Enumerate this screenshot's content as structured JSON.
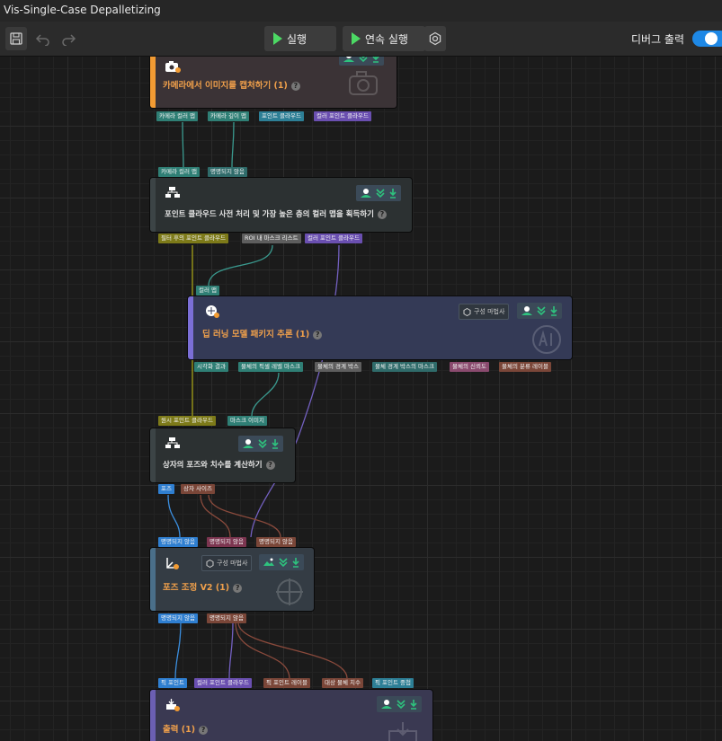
{
  "app": {
    "title": "Vis-Single-Case Depalletizing"
  },
  "toolbar": {
    "run_label": "실행",
    "continuous_run_label": "연속 실행",
    "debug_output_label": "디버그 출력",
    "debug_output_on": true
  },
  "colors": {
    "accent": "#1e88e5",
    "play": "#4cd964",
    "node_title_orange": "#f0a04b",
    "port_teal": "#2f7f75",
    "port_purple": "#6a4fb0",
    "port_olive": "#7d7a19",
    "port_brown": "#7a4638",
    "port_blue": "#2f7fd1"
  },
  "nodes": {
    "capture": {
      "title": "카메라에서 이미지를 캡처하기 (1)",
      "outputs": [
        "카메라 컬러 맵",
        "카메라 깊이 맵",
        "포인트 클라우드",
        "컬러 포인트 클라우드"
      ]
    },
    "preprocess": {
      "inputs": [
        "카메라 컬러 맵",
        "명명되지 않음"
      ],
      "title": "포인트 클라우드 사전 처리 및 가장 높은 층의 컬러 맵을 획득하기",
      "outputs": [
        "필터 후의 포인트 클라우드",
        "ROI 내 마스크 리스트",
        "컬러 포인트 클라우드"
      ]
    },
    "deep": {
      "inputs": [
        "컬러 맵"
      ],
      "config_label": "구성 마법사",
      "title": "딥 러닝 모델 패키지 추론 (1)",
      "outputs": [
        "시각화 결과",
        "물체의 픽셀 레벨 마스크",
        "물체의 경계 박스",
        "물체 경계 박스의 마스크",
        "물체의 신뢰도",
        "물체의 분류 레이블"
      ]
    },
    "box": {
      "inputs": [
        "원시 포인트 클라우드",
        "마스크 이미지"
      ],
      "title": "상자의 포즈와 치수를 계산하기",
      "outputs": [
        "포즈",
        "상자 사이즈"
      ]
    },
    "pose": {
      "inputs": [
        "명명되지 않음",
        "명명되지 않음",
        "명명되지 않음"
      ],
      "config_label": "구성 마법사",
      "title": "포즈 조정 V2 (1)",
      "outputs": [
        "명명되지 않음",
        "명명되지 않음"
      ]
    },
    "output": {
      "inputs": [
        "픽 포인트",
        "컬러 포인트 클라우드",
        "픽 포인트 레이블",
        "대상 물체 치수",
        "픽 포인트 중첩"
      ],
      "title": "출력 (1)"
    }
  }
}
